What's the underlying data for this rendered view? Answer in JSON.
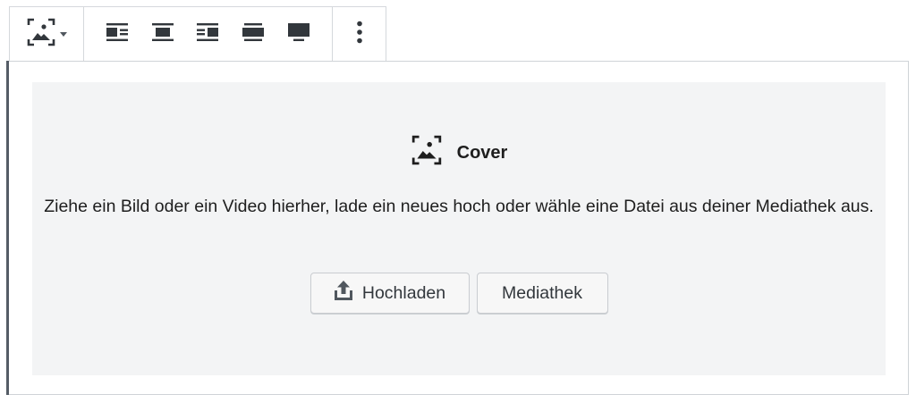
{
  "toolbar": {
    "block_switcher": {
      "icon": "cover-image-icon"
    },
    "alignments": [
      {
        "id": "align-left",
        "icon": "align-left-icon"
      },
      {
        "id": "align-center",
        "icon": "align-center-icon"
      },
      {
        "id": "align-right",
        "icon": "align-right-icon"
      },
      {
        "id": "align-wide",
        "icon": "align-wide-icon"
      },
      {
        "id": "align-full",
        "icon": "align-full-icon"
      }
    ],
    "more": {
      "icon": "more-vertical-icon"
    }
  },
  "placeholder": {
    "title": "Cover",
    "instructions": "Ziehe ein Bild oder ein Video hierher, lade ein neues hoch oder wähle eine Datei aus deiner Mediathek aus.",
    "upload_label": "Hochladen",
    "media_label": "Mediathek"
  },
  "colors": {
    "placeholder_bg": "#f3f4f5",
    "accent_border": "#555d66",
    "text": "#1e1e1e"
  }
}
